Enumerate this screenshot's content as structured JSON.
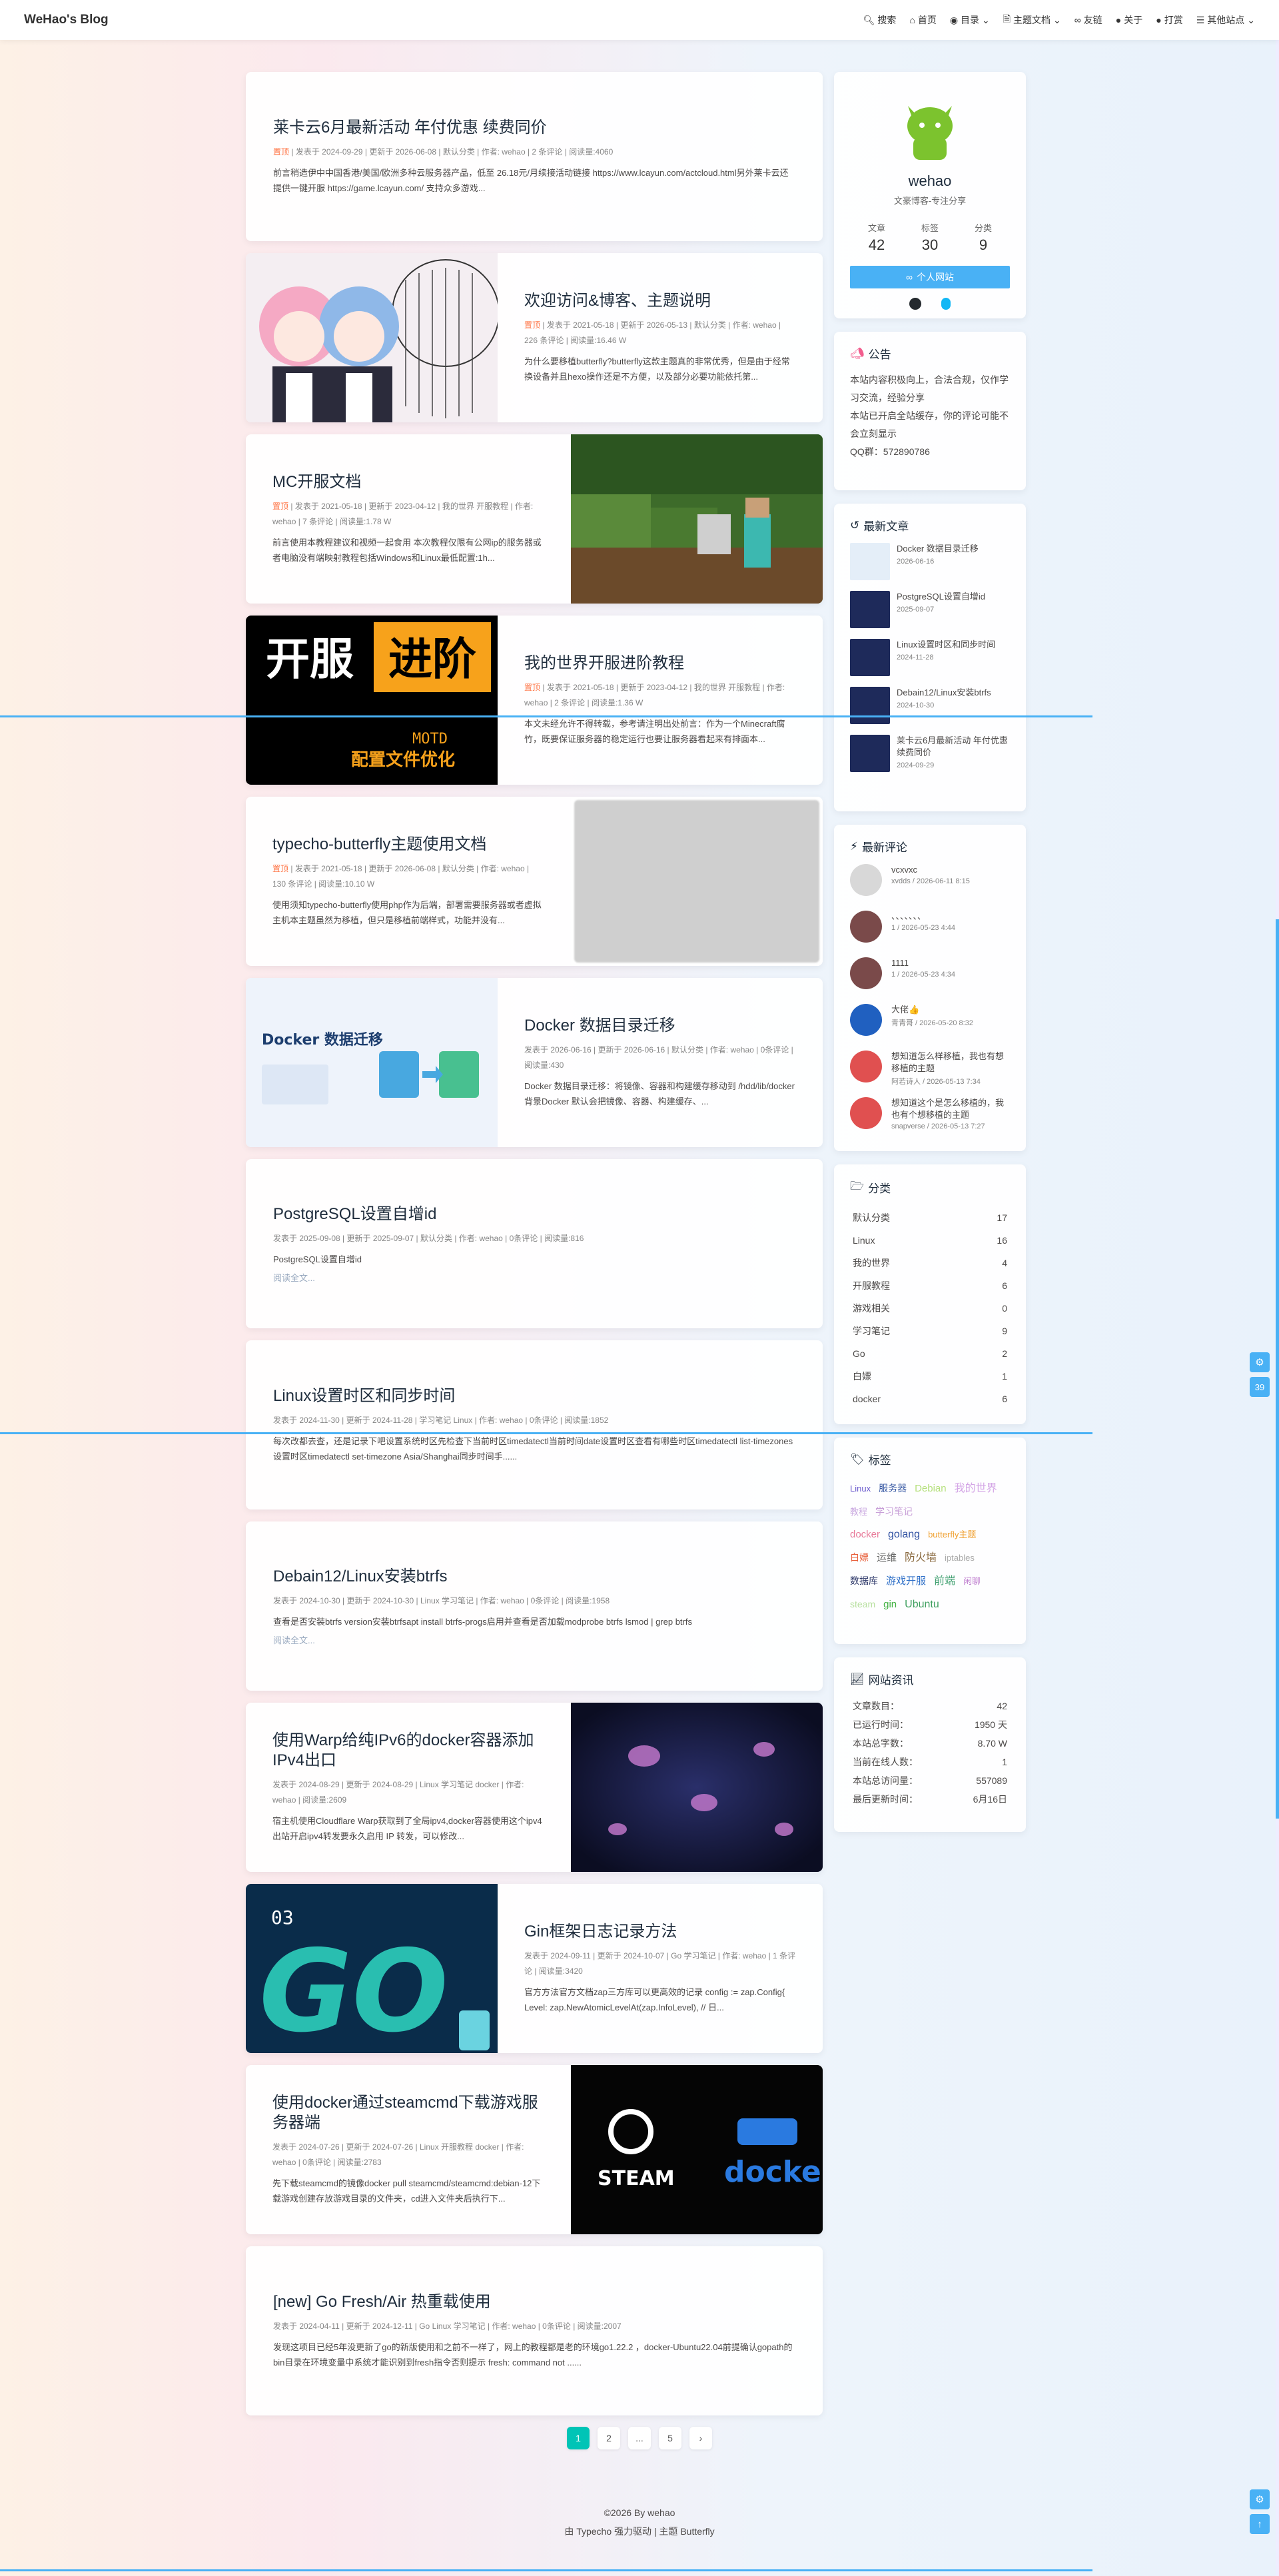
{
  "nav": {
    "brand": "WeHao's Blog",
    "menus": [
      "搜索",
      "首页",
      "目录",
      "主题文档",
      "友链",
      "关于",
      "打赏",
      "其他站点"
    ]
  },
  "posts": [
    {
      "title": "莱卡云6月最新活动 年付优惠 续费同价",
      "sticky": "置顶",
      "meta": "发表于 2024-09-29 | 更新于 2026-06-08 | 默认分类 | 作者: wehao | 2 条评论 | 阅读量:4060",
      "excerpt": "前言稍造伊中中国香港/美国/欧洲多种云服务器产品，低至 26.18元/月续接活动链接 https://www.lcayun.com/actcloud.html另外莱卡云还提供一键开服 https://game.lcayun.com/ 支持众多游戏..."
    },
    {
      "title": "欢迎访问&博客、主题说明",
      "sticky": "置顶",
      "meta": "发表于 2021-05-18 | 更新于 2026-05-13 | 默认分类 | 作者: wehao | 226 条评论 | 阅读量:16.46 W",
      "excerpt": "为什么要移植butterfly?butterfly这款主题真的非常优秀，但是由于经常换设备并且hexo操作还是不方便，以及部分必要功能依托第..."
    },
    {
      "title": "MC开服文档",
      "sticky": "置顶",
      "meta": "发表于 2021-05-18 | 更新于 2023-04-12 | 我的世界 开服教程 | 作者: wehao | 7 条评论 | 阅读量:1.78 W",
      "excerpt": "前言使用本教程建议和视频一起食用 本次教程仅限有公网ip的服务器或者电脑没有端映射教程包括Windows和Linux最低配置:1h..."
    },
    {
      "title": "我的世界开服进阶教程",
      "sticky": "置顶",
      "meta": "发表于 2021-05-18 | 更新于 2023-04-12 | 我的世界 开服教程 | 作者: wehao | 2 条评论 | 阅读量:1.36 W",
      "excerpt": "本文未经允许不得转载，参考请注明出处前言：作为一个Minecraft腐竹，既要保证服务器的稳定运行也要让服务器看起来有排面本..."
    },
    {
      "title": "typecho-butterfly主题使用文档",
      "sticky": "置顶",
      "meta": "发表于 2021-05-18 | 更新于 2026-06-08 | 默认分类 | 作者: wehao | 130 条评论 | 阅读量:10.10 W",
      "excerpt": "使用须知typecho-butterfly使用php作为后端，部署需要服务器或者虚拟主机本主题虽然为移植，但只是移植前端样式，功能并没有..."
    },
    {
      "title": "Docker 数据目录迁移",
      "sticky": "",
      "meta": "发表于 2026-06-16 | 更新于 2026-06-16 | 默认分类 | 作者: wehao | 0条评论 | 阅读量:430",
      "excerpt": "Docker 数据目录迁移：将镜像、容器和构建缓存移动到 /hdd/lib/docker背景Docker 默认会把镜像、容器、构建缓存、..."
    },
    {
      "title": "PostgreSQL设置自增id",
      "sticky": "",
      "meta": "发表于 2025-09-08 | 更新于 2025-09-07 | 默认分类 | 作者: wehao | 0条评论 | 阅读量:816",
      "excerpt": "PostgreSQL设置自增id",
      "readmore": "阅读全文..."
    },
    {
      "title": "Linux设置时区和同步时间",
      "sticky": "",
      "meta": "发表于 2024-11-30 | 更新于 2024-11-28 | 学习笔记 Linux | 作者: wehao | 0条评论 | 阅读量:1852",
      "excerpt": "每次改都去查，还是记录下吧设置系统时区先检查下当前时区timedatectl当前时间date设置时区查看有哪些时区timedatectl list-timezones设置时区timedatectl set-timezone Asia/Shanghai同步时间手......"
    },
    {
      "title": "Debain12/Linux安装btrfs",
      "sticky": "",
      "meta": "发表于 2024-10-30 | 更新于 2024-10-30 | Linux 学习笔记 | 作者: wehao | 0条评论 | 阅读量:1958",
      "excerpt": "查看是否安装btrfs version安装btrfsapt install btrfs-progs启用并查看是否加载modprobe btrfs lsmod | grep btrfs",
      "readmore": "阅读全文..."
    },
    {
      "title": "使用Warp给纯IPv6的docker容器添加IPv4出口",
      "sticky": "",
      "meta": "发表于 2024-08-29 | 更新于 2024-08-29 | Linux 学习笔记 docker | 作者: wehao | 阅读量:2609",
      "excerpt": "宿主机使用Cloudflare Warp获取到了全局ipv4,docker容器使用这个ipv4出站开启ipv4转发要永久启用 IP 转发，可以修改..."
    },
    {
      "title": "Gin框架日志记录方法",
      "sticky": "",
      "meta": "发表于 2024-09-11 | 更新于 2024-10-07 | Go 学习笔记 | 作者: wehao | 1 条评论 | 阅读量:3420",
      "excerpt": "官方方法官方文档zap三方库可以更高效的记录 config := zap.Config{ Level: zap.NewAtomicLevelAt(zap.InfoLevel), // 日..."
    },
    {
      "title": "使用docker通过steamcmd下载游戏服务器端",
      "sticky": "",
      "meta": "发表于 2024-07-26 | 更新于 2024-07-26 | Linux 开服教程 docker | 作者: wehao | 0条评论 | 阅读量:2783",
      "excerpt": "先下载steamcmd的镜像docker pull steamcmd/steamcmd:debian-12下载游戏创建存放游戏目录的文件夹，cd进入文件夹后执行下..."
    },
    {
      "title": "[new] Go Fresh/Air 热重载使用",
      "sticky": "",
      "meta": "发表于 2024-04-11 | 更新于 2024-12-11 | Go Linux 学习笔记 | 作者: wehao | 0条评论 | 阅读量:2007",
      "excerpt": "发现这项目已经5年没更新了go的新版使用和之前不一样了，网上的教程都是老的环境go1.22.2 ，docker-Ubuntu22.04前提确认gopath的bin目录在环境变量中系统才能识别到fresh指令否则提示 fresh: command not ......"
    }
  ],
  "author": {
    "name": "wehao",
    "desc": "文豪博客-专注分享",
    "stats": [
      {
        "label": "文章",
        "value": "42"
      },
      {
        "label": "标签",
        "value": "30"
      },
      {
        "label": "分类",
        "value": "9"
      }
    ],
    "button": "个人网站"
  },
  "announcement": {
    "title": "公告",
    "lines": [
      "本站内容积极向上，合法合规，仅作学习交流，经验分享",
      "本站已开启全站缓存，你的评论可能不会立刻显示",
      "QQ群：572890786"
    ]
  },
  "recent": {
    "title": "最新文章",
    "items": [
      {
        "title": "Docker 数据目录迁移",
        "date": "2026-06-16"
      },
      {
        "title": "PostgreSQL设置自增id",
        "date": "2025-09-07"
      },
      {
        "title": "Linux设置时区和同步时间",
        "date": "2024-11-28"
      },
      {
        "title": "Debain12/Linux安装btrfs",
        "date": "2024-10-30"
      },
      {
        "title": "莱卡云6月最新活动 年付优惠 续费同价",
        "date": "2024-09-29"
      }
    ]
  },
  "comments": {
    "title": "最新评论",
    "items": [
      {
        "text": "vcxvxc",
        "meta": "xvdds / 2026-06-11 8:15"
      },
      {
        "text": "、、、、、、、",
        "meta": "1 / 2026-05-23 4:44"
      },
      {
        "text": "1111",
        "meta": "1 / 2026-05-23 4:34"
      },
      {
        "text": "大佬👍",
        "meta": "青青哥 / 2026-05-20 8:32"
      },
      {
        "text": "想知道怎么样移植，我也有想移植的主题",
        "meta": "阿若诗人 / 2026-05-13 7:34"
      },
      {
        "text": "想知道这个是怎么移植的，我也有个想移植的主题",
        "meta": "snapverse / 2026-05-13 7:27"
      }
    ]
  },
  "categories": {
    "title": "分类",
    "items": [
      {
        "name": "默认分类",
        "count": "17"
      },
      {
        "name": "Linux",
        "count": "16"
      },
      {
        "name": "我的世界",
        "count": "4"
      },
      {
        "name": "开服教程",
        "count": "6"
      },
      {
        "name": "游戏相关",
        "count": "0"
      },
      {
        "name": "学习笔记",
        "count": "9"
      },
      {
        "name": "Go",
        "count": "2"
      },
      {
        "name": "白嫖",
        "count": "1"
      },
      {
        "name": "docker",
        "count": "6"
      }
    ]
  },
  "tags": {
    "title": "标签",
    "items": [
      {
        "name": "Linux",
        "color": "#6a5acd"
      },
      {
        "name": "服务器",
        "color": "#3b5ba5"
      },
      {
        "name": "Debian",
        "color": "#b6e07e"
      },
      {
        "name": "我的世界",
        "color": "#d4a6e6"
      },
      {
        "name": "教程",
        "color": "#c9a8e0"
      },
      {
        "name": "学习笔记",
        "color": "#c8a0d8"
      },
      {
        "name": "docker",
        "color": "#e87b9a"
      },
      {
        "name": "golang",
        "color": "#2d4ea0"
      },
      {
        "name": "butterfly主题",
        "color": "#f0a030"
      },
      {
        "name": "白嫖",
        "color": "#e8603c"
      },
      {
        "name": "运维",
        "color": "#6b6b6b"
      },
      {
        "name": "防火墙",
        "color": "#8a6a40"
      },
      {
        "name": "iptables",
        "color": "#aaaaaa"
      },
      {
        "name": "数据库",
        "color": "#2f3a6b"
      },
      {
        "name": "游戏开服",
        "color": "#3070c8"
      },
      {
        "name": "前端",
        "color": "#40a070"
      },
      {
        "name": "闲聊",
        "color": "#c080d0"
      },
      {
        "name": "steam",
        "color": "#b8e0a0"
      },
      {
        "name": "gin",
        "color": "#40b040"
      },
      {
        "name": "Ubuntu",
        "color": "#40a060"
      }
    ]
  },
  "siteinfo": {
    "title": "网站资讯",
    "rows": [
      {
        "k": "文章数目：",
        "v": "42"
      },
      {
        "k": "已运行时间：",
        "v": "1950 天"
      },
      {
        "k": "本站总字数：",
        "v": "8.70 W"
      },
      {
        "k": "当前在线人数：",
        "v": "1"
      },
      {
        "k": "本站总访问量：",
        "v": "557089"
      },
      {
        "k": "最后更新时间：",
        "v": "6月16日"
      }
    ]
  },
  "pager": [
    "1",
    "2",
    "...",
    "5"
  ],
  "footer": {
    "line1": "©2026 By wehao",
    "line2": "由 Typecho 强力驱动 | 主题 Butterfly"
  },
  "rightbar": {
    "badge": "39"
  }
}
